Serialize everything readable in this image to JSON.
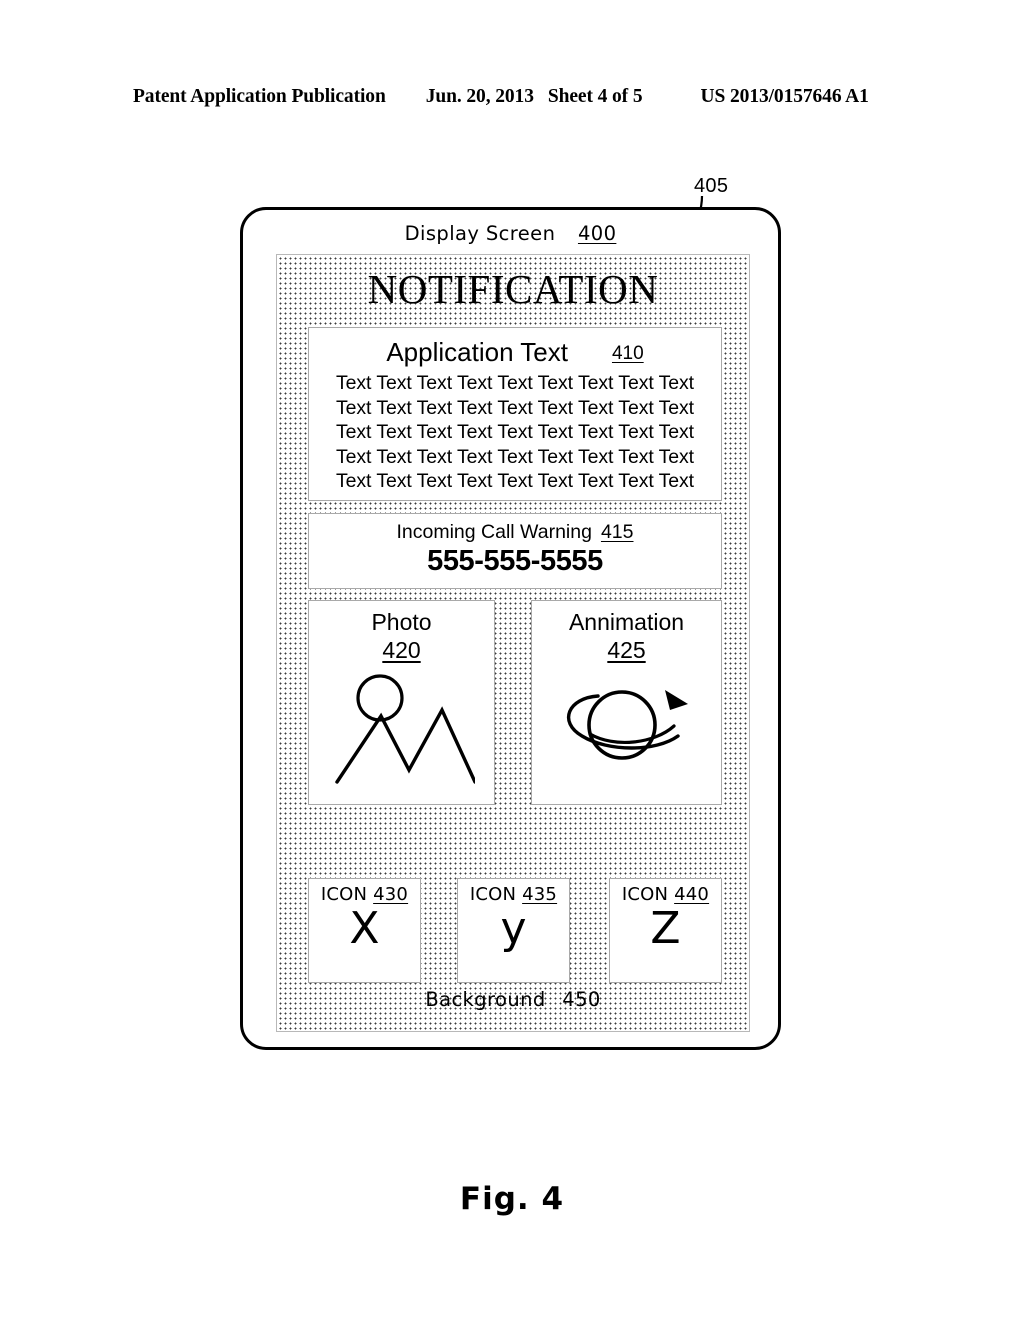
{
  "page_header": {
    "publication": "Patent Application Publication",
    "date": "Jun. 20, 2013",
    "sheet": "Sheet 4 of 5",
    "patent_number": "US 2013/0157646 A1"
  },
  "figure": {
    "caption": "Fig. 4",
    "callout_405": "405"
  },
  "device": {
    "screen_label": "Display Screen",
    "screen_ref": "400",
    "notification_title": "NOTIFICATION",
    "background_label": "Background",
    "background_ref": "450"
  },
  "app_text": {
    "heading": "Application Text",
    "ref": "410",
    "lines": [
      "Text Text Text Text Text Text Text Text Text",
      "Text Text Text Text Text Text Text Text Text",
      "Text Text Text Text Text Text Text Text Text",
      "Text Text Text Text Text Text Text Text Text",
      "Text Text Text Text Text Text Text Text Text"
    ]
  },
  "incoming_call": {
    "heading": "Incoming Call Warning",
    "ref": "415",
    "number": "555-555-5555"
  },
  "media": {
    "photo": {
      "title": "Photo",
      "ref": "420",
      "art": "mountain-sun-photo-icon"
    },
    "animation": {
      "title": "Annimation",
      "ref": "425",
      "art": "orbiting-sphere-icon"
    }
  },
  "icons": [
    {
      "label": "ICON",
      "ref": "430",
      "glyph": "X",
      "name": "icon-x"
    },
    {
      "label": "ICON",
      "ref": "435",
      "glyph": "y",
      "name": "icon-y"
    },
    {
      "label": "ICON",
      "ref": "440",
      "glyph": "Z",
      "name": "icon-z"
    }
  ],
  "colors": {
    "ink": "#000000",
    "paper": "#ffffff",
    "panel_border": "#a9a9a9",
    "stipple_dot": "#3b3b3b"
  }
}
